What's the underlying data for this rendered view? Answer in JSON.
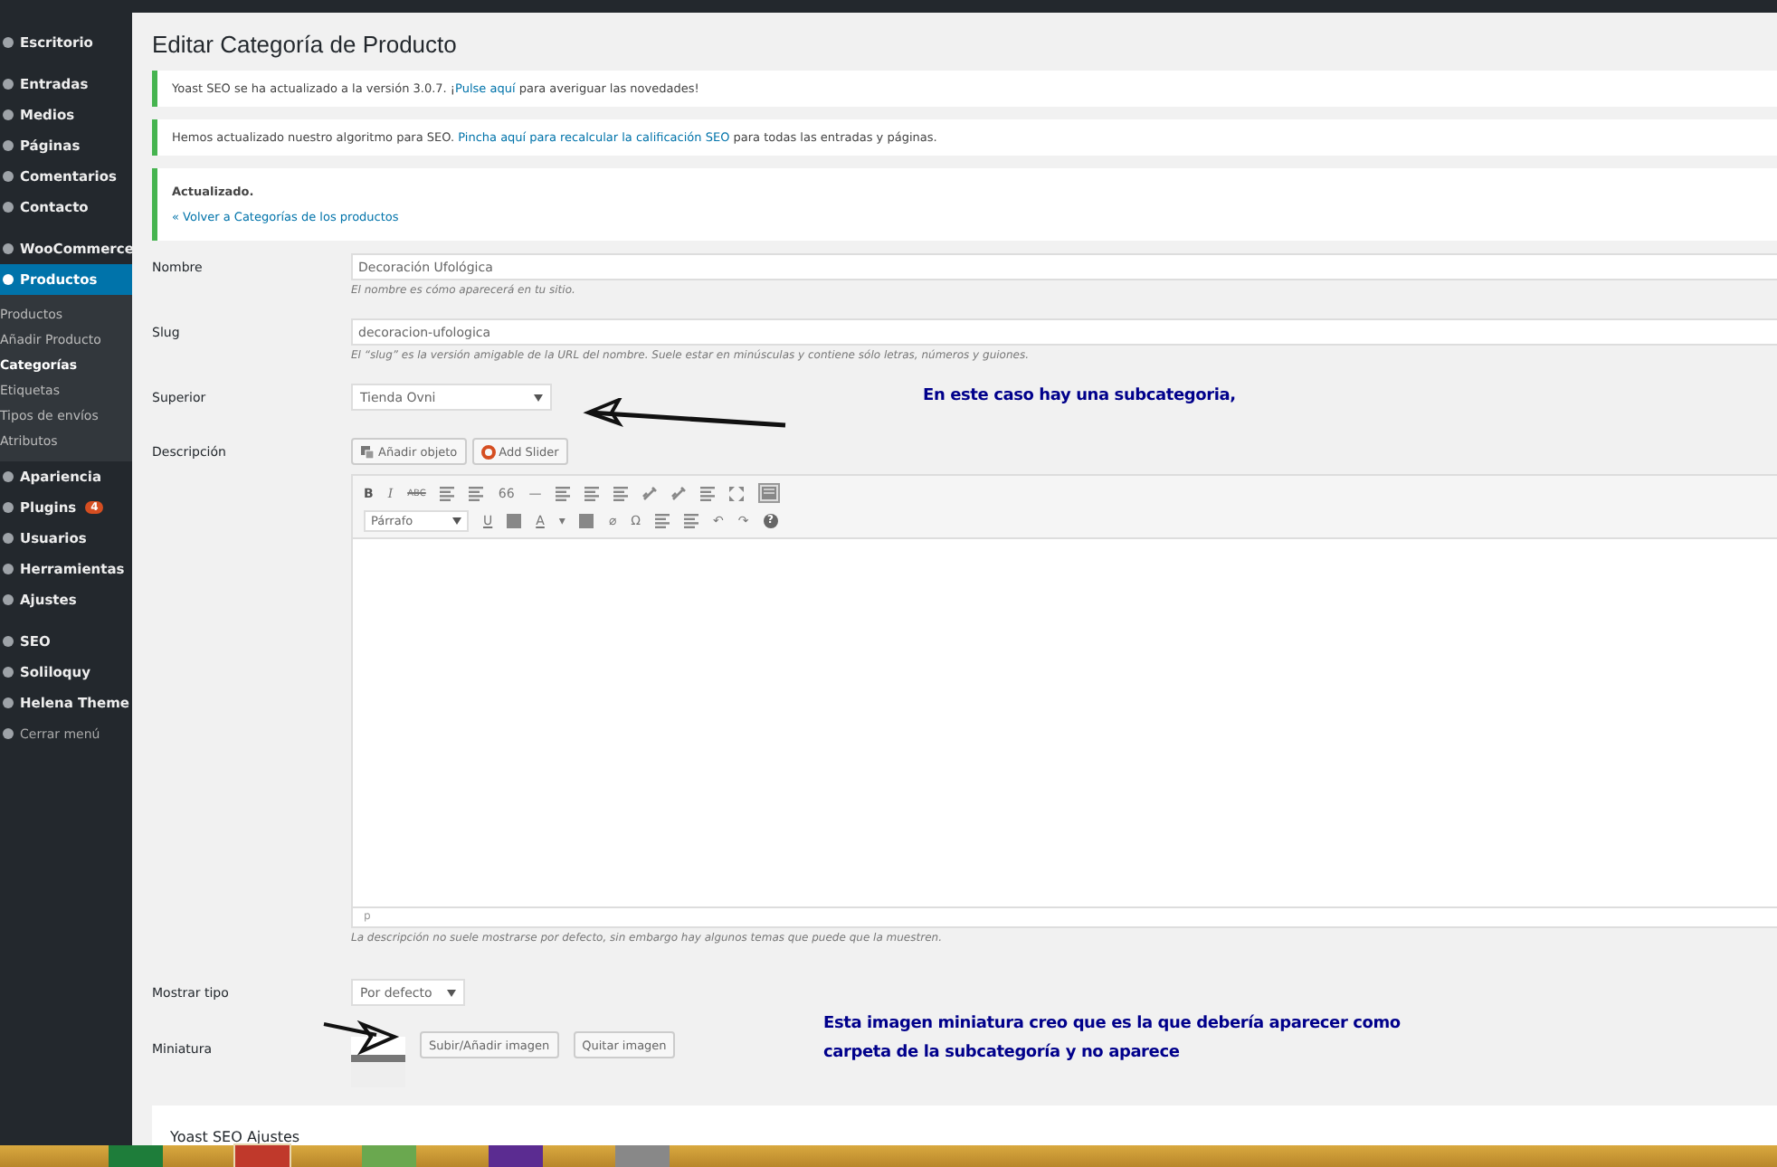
{
  "sidebar": {
    "groups": [
      [
        {
          "label": "Escritorio",
          "selected": false
        }
      ],
      [
        {
          "label": "Entradas",
          "selected": false
        },
        {
          "label": "Medios",
          "selected": false
        },
        {
          "label": "Páginas",
          "selected": false
        },
        {
          "label": "Comentarios",
          "selected": false
        },
        {
          "label": "Contacto",
          "selected": false
        }
      ],
      [
        {
          "label": "WooCommerce",
          "selected": false
        },
        {
          "label": "Productos",
          "selected": true,
          "children": [
            {
              "label": "Productos",
              "selected": false
            },
            {
              "label": "Añadir Producto",
              "selected": false
            },
            {
              "label": "Categorías",
              "selected": true
            },
            {
              "label": "Etiquetas",
              "selected": false
            },
            {
              "label": "Tipos de envíos",
              "selected": false
            },
            {
              "label": "Atributos",
              "selected": false
            }
          ]
        },
        {
          "label": "Apariencia",
          "selected": false
        },
        {
          "label": "Plugins",
          "selected": false,
          "badge": "4"
        },
        {
          "label": "Usuarios",
          "selected": false
        },
        {
          "label": "Herramientas",
          "selected": false
        },
        {
          "label": "Ajustes",
          "selected": false
        }
      ],
      [
        {
          "label": "SEO",
          "selected": false
        },
        {
          "label": "Soliloquy",
          "selected": false
        },
        {
          "label": "Helena Theme",
          "selected": false
        },
        {
          "label": "Cerrar menú",
          "selected": false,
          "kind": "collapse"
        }
      ]
    ]
  },
  "page": {
    "title": "Editar Categoría de Producto",
    "notices": [
      {
        "lines": [
          [
            {
              "kind": "text",
              "text": "Yoast SEO se ha actualizado a la versión 3.0.7. ¡"
            },
            {
              "kind": "link",
              "text": "Pulse aquí"
            },
            {
              "kind": "text",
              "text": " para averiguar las novedades!"
            }
          ]
        ]
      },
      {
        "lines": [
          [
            {
              "kind": "text",
              "text": "Hemos actualizado nuestro algoritmo para SEO. "
            },
            {
              "kind": "link",
              "text": "Pincha aquí para recalcular la calificación SEO"
            },
            {
              "kind": "text",
              "text": " para todas las entradas y páginas."
            }
          ]
        ]
      },
      {
        "lines": [
          [
            {
              "kind": "strong",
              "text": "Actualizado."
            }
          ],
          [
            {
              "kind": "link",
              "text": "« Volver a Categorías de los productos"
            }
          ]
        ]
      }
    ],
    "form": {
      "name": {
        "label": "Nombre",
        "value": "Decoración Ufológica",
        "help": "El nombre es cómo aparecerá en tu sitio."
      },
      "slug": {
        "label": "Slug",
        "value": "decoracion-ufologica",
        "help": "El “slug” es la versión amigable de la URL del nombre. Suele estar en minúsculas y contiene sólo letras, números y guiones."
      },
      "parent": {
        "label": "Superior",
        "value": "Tienda Ovni"
      },
      "description": {
        "label": "Descripción",
        "media_buttons": [
          "Añadir objeto",
          "Add Slider"
        ],
        "toolbar": [
          [
            {
              "kind": "bold",
              "text": "B"
            },
            {
              "kind": "italic",
              "text": "I"
            },
            {
              "kind": "strike",
              "text": "ABC"
            },
            {
              "kind": "lines"
            },
            {
              "kind": "lines"
            },
            {
              "kind": "glyph",
              "text": "66"
            },
            {
              "kind": "glyph",
              "text": "—"
            },
            {
              "kind": "lines"
            },
            {
              "kind": "lines"
            },
            {
              "kind": "lines"
            },
            {
              "kind": "link"
            },
            {
              "kind": "link"
            },
            {
              "kind": "lines"
            },
            {
              "kind": "expand"
            },
            {
              "kind": "toggle",
              "on": true
            }
          ],
          [
            {
              "kind": "select",
              "text": "Párrafo"
            },
            {
              "kind": "underline",
              "text": "U"
            },
            {
              "kind": "square"
            },
            {
              "kind": "underline",
              "text": "A"
            },
            {
              "kind": "glyph",
              "text": "▾"
            },
            {
              "kind": "square"
            },
            {
              "kind": "glyph",
              "text": "⌀"
            },
            {
              "kind": "glyph",
              "text": "Ω"
            },
            {
              "kind": "lines"
            },
            {
              "kind": "lines"
            },
            {
              "kind": "glyph",
              "text": "↶"
            },
            {
              "kind": "glyph",
              "text": "↷"
            },
            {
              "kind": "help",
              "text": "?"
            }
          ]
        ],
        "path": "p",
        "help": "La descripción no suele mostrarse por defecto, sin embargo hay algunos temas que puede que la muestren."
      },
      "display": {
        "label": "Mostrar tipo",
        "value": "Por defecto"
      },
      "thumbnail": {
        "label": "Miniatura",
        "buttons": [
          "Subir/Añadir imagen",
          "Quitar imagen"
        ]
      }
    },
    "panel": {
      "title": "Yoast SEO Ajustes"
    }
  },
  "annotations": [
    {
      "lines": [
        "En este caso hay una subcategoria,"
      ]
    },
    {
      "lines": [
        "Esta imagen miniatura creo que es la que debería aparecer como",
        "carpeta de la subcategoría y no aparece"
      ]
    }
  ]
}
